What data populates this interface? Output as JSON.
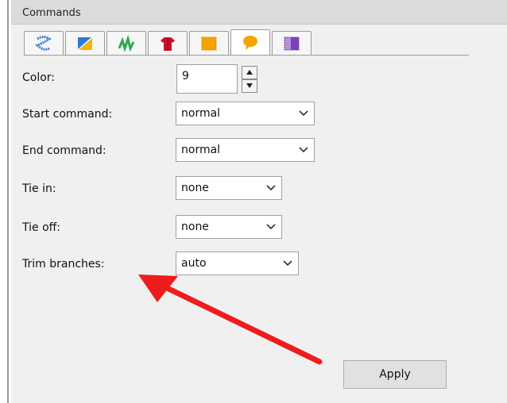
{
  "panel": {
    "title": "Commands"
  },
  "tabs": [
    {
      "icon": "satin-stitch-icon"
    },
    {
      "icon": "fill-pattern-icon"
    },
    {
      "icon": "running-stitch-icon"
    },
    {
      "icon": "shirt-icon"
    },
    {
      "icon": "fabric-swatch-icon"
    },
    {
      "icon": "speech-bubble-icon",
      "active": true
    },
    {
      "icon": "appliqué-icon"
    }
  ],
  "fields": {
    "color": {
      "label": "Color:",
      "value": "9"
    },
    "start_command": {
      "label": "Start command:",
      "value": "normal"
    },
    "end_command": {
      "label": "End command:",
      "value": "normal"
    },
    "tie_in": {
      "label": "Tie in:",
      "value": "none"
    },
    "tie_off": {
      "label": "Tie off:",
      "value": "none"
    },
    "trim_branches": {
      "label": "Trim branches:",
      "value": "auto"
    }
  },
  "apply_label": "Apply",
  "colors": {
    "annotation_arrow": "#ee1c1c",
    "active_tab_icon": "#f5a300"
  }
}
